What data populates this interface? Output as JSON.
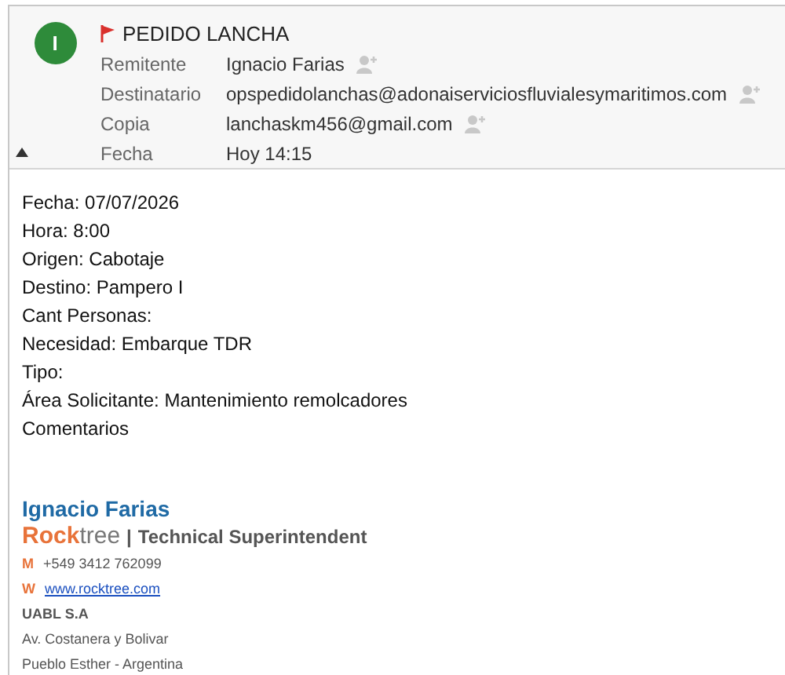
{
  "header": {
    "avatar_letter": "I",
    "flagged": true,
    "subject": "PEDIDO LANCHA",
    "collapsed": false,
    "fields": [
      {
        "label": "Remitente",
        "value": "Ignacio Farias",
        "add_contact": true
      },
      {
        "label": "Destinatario",
        "value": "opspedidolanchas@adonaiserviciosfluvialesymaritimos.com",
        "add_contact": true
      },
      {
        "label": "Copia",
        "value": "lanchaskm456@gmail.com",
        "add_contact": true
      },
      {
        "label": "Fecha",
        "value": "Hoy 14:15",
        "add_contact": false
      }
    ]
  },
  "body": {
    "lines": [
      "Fecha: 07/07/2026",
      "Hora: 8:00",
      "Origen: Cabotaje",
      "Destino: Pampero I",
      "Cant Personas:",
      "Necesidad: Embarque TDR",
      "Tipo:",
      "Área Solicitante: Mantenimiento remolcadores",
      "Comentarios"
    ]
  },
  "signature": {
    "name": "Ignacio Farias",
    "company": "**Rock**tree",
    "separator": "|",
    "role": "Technical Superintendent",
    "contacts": [
      {
        "key": "M",
        "value": "+549 3412 762099",
        "kind": "text"
      },
      {
        "key": "W",
        "value": "www.rocktree.com",
        "kind": "link"
      }
    ],
    "org": "UABL S.A",
    "address": [
      "Av. Costanera y Bolivar",
      "Pueblo Esther - Argentina"
    ]
  }
}
